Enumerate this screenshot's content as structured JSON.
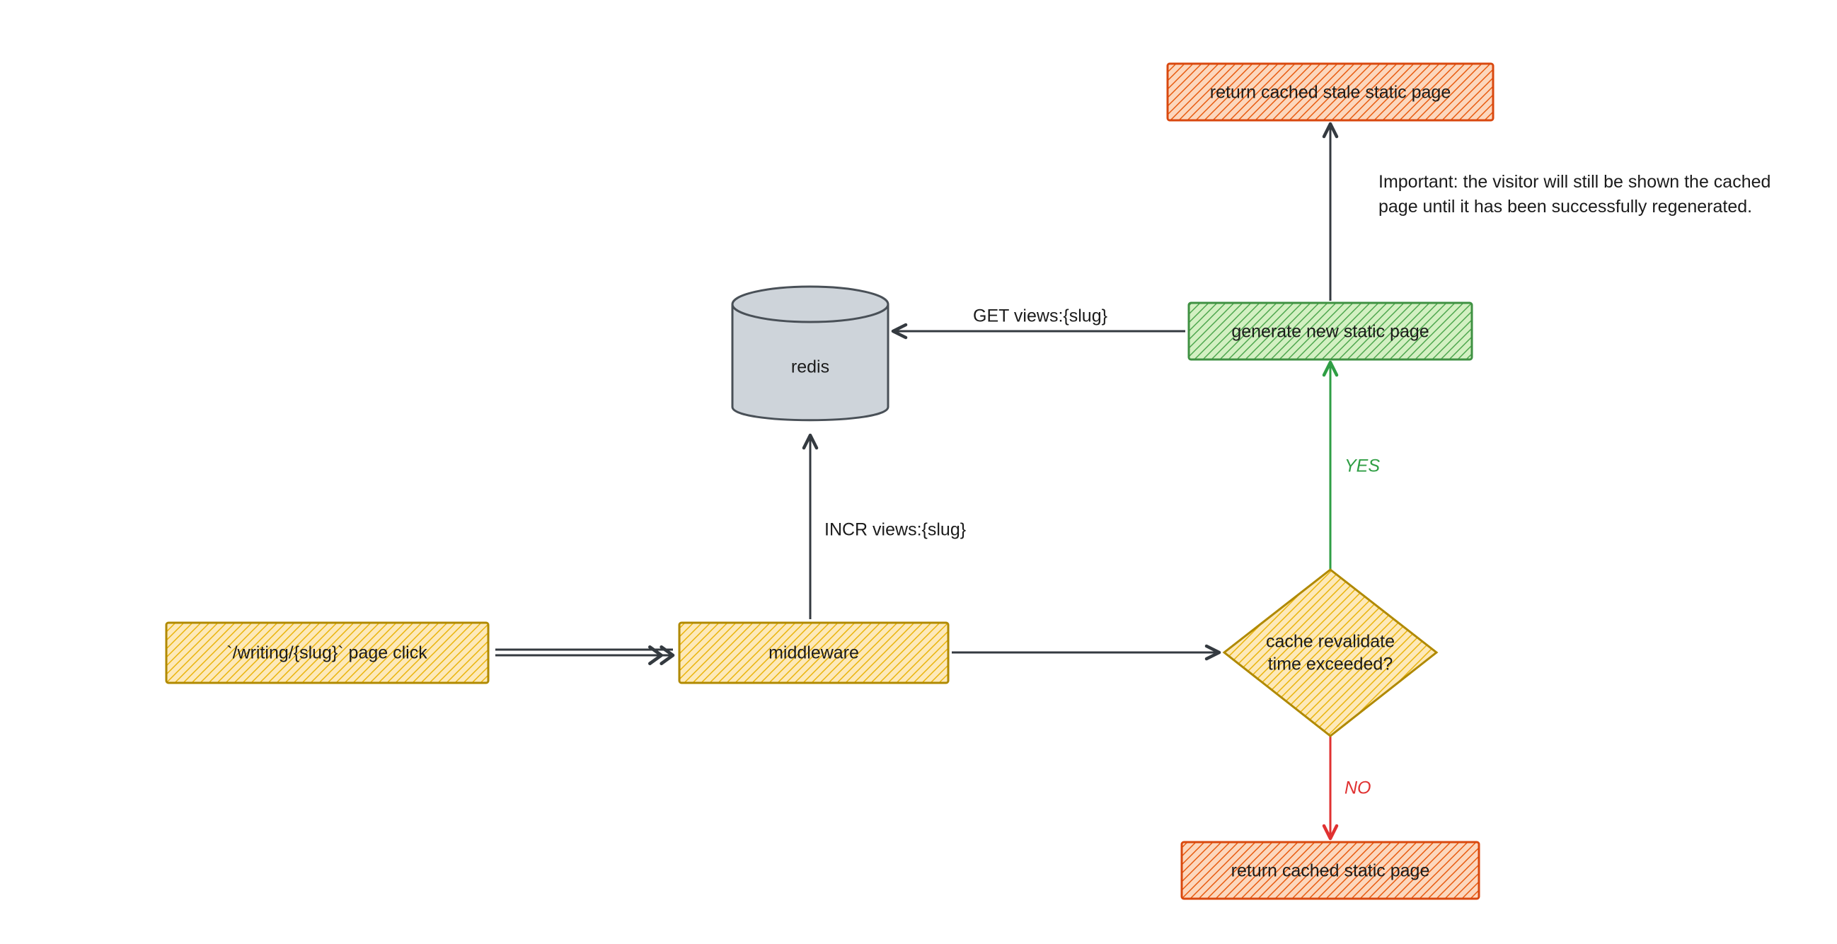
{
  "nodes": {
    "page_click": {
      "label": "`/writing/{slug}` page click"
    },
    "middleware": {
      "label": "middleware"
    },
    "redis": {
      "label": "redis"
    },
    "decision": {
      "line1": "cache revalidate",
      "line2": "time exceeded?"
    },
    "generate": {
      "label": "generate new static page"
    },
    "return_stale": {
      "label": "return cached stale static page"
    },
    "return_cached": {
      "label": "return cached static page"
    }
  },
  "edges": {
    "incr": {
      "label": "INCR views:{slug}"
    },
    "get": {
      "label": "GET views:{slug}"
    },
    "yes": {
      "label": "YES"
    },
    "no": {
      "label": "NO"
    }
  },
  "note": {
    "line1": "Important: the visitor will still be shown the cached",
    "line2": "page until it has been successfully regenerated."
  },
  "colors": {
    "yellow_fill": "#fde9b9",
    "yellow_stroke": "#b08900",
    "green_fill": "#d3f0c2",
    "green_stroke": "#3f9142",
    "orange_fill": "#fcd7bd",
    "orange_stroke": "#d9480f",
    "grey_fill": "#ced4da",
    "grey_stroke": "#495057",
    "edge_stroke": "#343a40",
    "yes_stroke": "#2f9e44",
    "no_stroke": "#e03131"
  }
}
